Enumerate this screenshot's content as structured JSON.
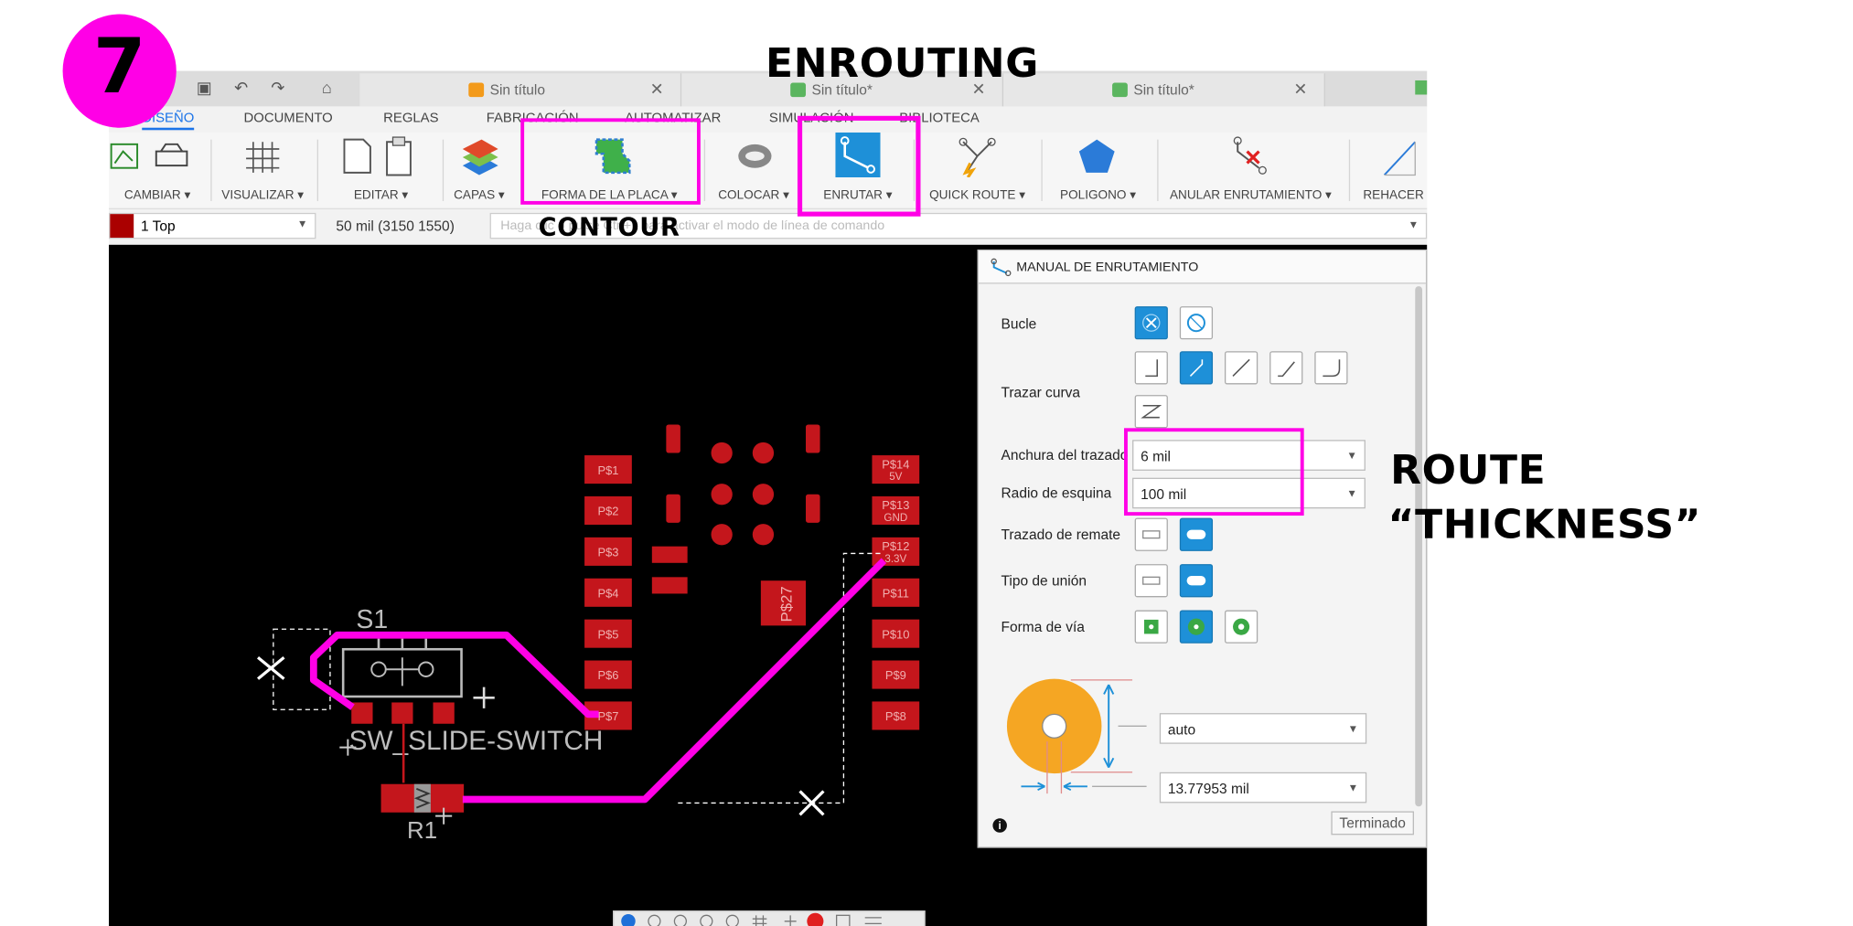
{
  "step_number": "7",
  "annotations": {
    "enrouting": "ENROUTING",
    "contour": "CONTOUR",
    "route_line1": "ROUTE",
    "route_line2": "“THICKNESS”"
  },
  "tabs": [
    {
      "label": "Sin título"
    },
    {
      "label": "Sin título*"
    },
    {
      "label": "Sin título*"
    }
  ],
  "menu": [
    "DISEÑO",
    "DOCUMENTO",
    "REGLAS",
    "FABRICACIÓN",
    "AUTOMATIZAR",
    "SIMULACIÓN",
    "BIBLIOTECA"
  ],
  "toolbar": {
    "cambiar": "CAMBIAR ▾",
    "visualizar": "VISUALIZAR ▾",
    "editar": "EDITAR ▾",
    "capas": "CAPAS ▾",
    "forma": "FORMA DE LA PLACA ▾",
    "colocar": "COLOCAR ▾",
    "enrutar": "ENRUTAR ▾",
    "quick": "QUICK ROUTE ▾",
    "poligono": "POLIGONO ▾",
    "anular": "ANULAR ENRUTAMIENTO ▾",
    "rehacer": "REHACER ▾"
  },
  "command": {
    "layer": "1 Top",
    "grid": "50 mil (3150 1550)",
    "placeholder": "Haga clic o pulse Ctrl+L para activar el modo de línea de comando"
  },
  "board": {
    "s1": "S1",
    "switch": "SW_SLIDE-SWITCH",
    "r1": "R1",
    "p27": "P$27",
    "left_pads": [
      "P$1",
      "P$2",
      "P$3",
      "P$4",
      "P$5",
      "P$6",
      "P$7"
    ],
    "right_pads": [
      "P$14",
      "P$13",
      "P$12",
      "P$11",
      "P$10",
      "P$9",
      "P$8"
    ],
    "right_pad_sub": [
      "5V",
      "GND",
      "3.3V"
    ]
  },
  "panel": {
    "title": "MANUAL DE ENRUTAMIENTO",
    "bucle": "Bucle",
    "trazar_curva": "Trazar curva",
    "anchura": "Anchura del trazado",
    "anchura_val": "6 mil",
    "radio": "Radio de esquina",
    "radio_val": "100 mil",
    "remate": "Trazado de remate",
    "union": "Tipo de unión",
    "via": "Forma de vía",
    "drill_val": "auto",
    "diam_val": "13.77953 mil",
    "done": "Terminado"
  },
  "colors": {
    "accent": "#ff00e6",
    "pad": "#c4161c",
    "select": "#1e90d8"
  }
}
